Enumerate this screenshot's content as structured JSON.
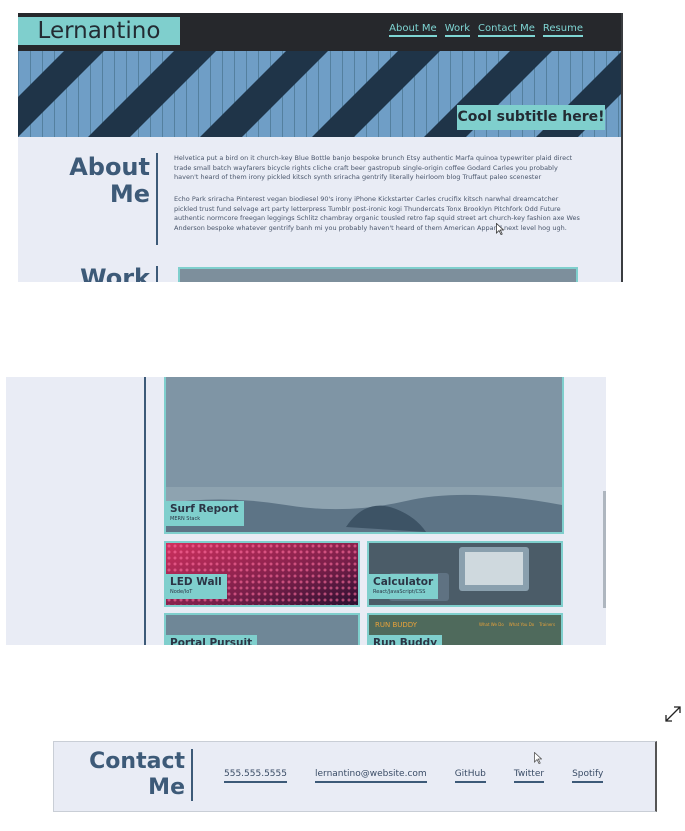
{
  "header": {
    "brand": "Lernantino",
    "nav": [
      "About Me",
      "Work",
      "Contact Me",
      "Resume"
    ]
  },
  "hero": {
    "subtitle": "Cool subtitle here!"
  },
  "about": {
    "title_line1": "About",
    "title_line2": "Me",
    "paragraphs": [
      "Helvetica put a bird on it church-key Blue Bottle banjo bespoke brunch Etsy authentic Marfa quinoa typewriter plaid direct trade small batch wayfarers bicycle rights cliche craft beer gastropub single-origin coffee Godard Carles you probably haven't heard of them irony pickled kitsch synth sriracha gentrify literally heirloom blog Truffaut paleo scenester",
      "Echo Park sriracha Pinterest vegan biodiesel 90's irony iPhone Kickstarter Carles crucifix kitsch narwhal dreamcatcher pickled trust fund selvage art party letterpress Tumblr post-ironic kogi Thundercats Tonx Brooklyn Pitchfork Odd Future authentic normcore freegan leggings Schlitz chambray organic tousled retro fap squid street art church-key fashion axe Wes Anderson bespoke whatever gentrify banh mi you probably haven't heard of them American Apparel next level hog ugh."
    ]
  },
  "work": {
    "title": "Work",
    "projects": [
      {
        "title": "Surf Report",
        "stack": "MERN Stack"
      },
      {
        "title": "LED Wall",
        "stack": "Node/IoT"
      },
      {
        "title": "Calculator",
        "stack": "React/JavaScript/CSS"
      },
      {
        "title": "Portal Pursuit",
        "stack": ""
      },
      {
        "title": "Run Buddy",
        "stack": ""
      }
    ],
    "run_buddy_banner": "RUN BUDDY",
    "run_buddy_menu": [
      "What We Do",
      "What You Do",
      "Trainers"
    ]
  },
  "contact": {
    "title_line1": "Contact",
    "title_line2": "Me",
    "links": [
      "555.555.5555",
      "lernantino@website.com",
      "GitHub",
      "Twitter",
      "Spotify"
    ]
  },
  "colors": {
    "accent": "#7fcfcd",
    "dark": "#26282c",
    "heading": "#3d5a78",
    "background": "#e9ecf5"
  },
  "icons": [
    "mouse-cursor-icon",
    "expand-icon"
  ]
}
